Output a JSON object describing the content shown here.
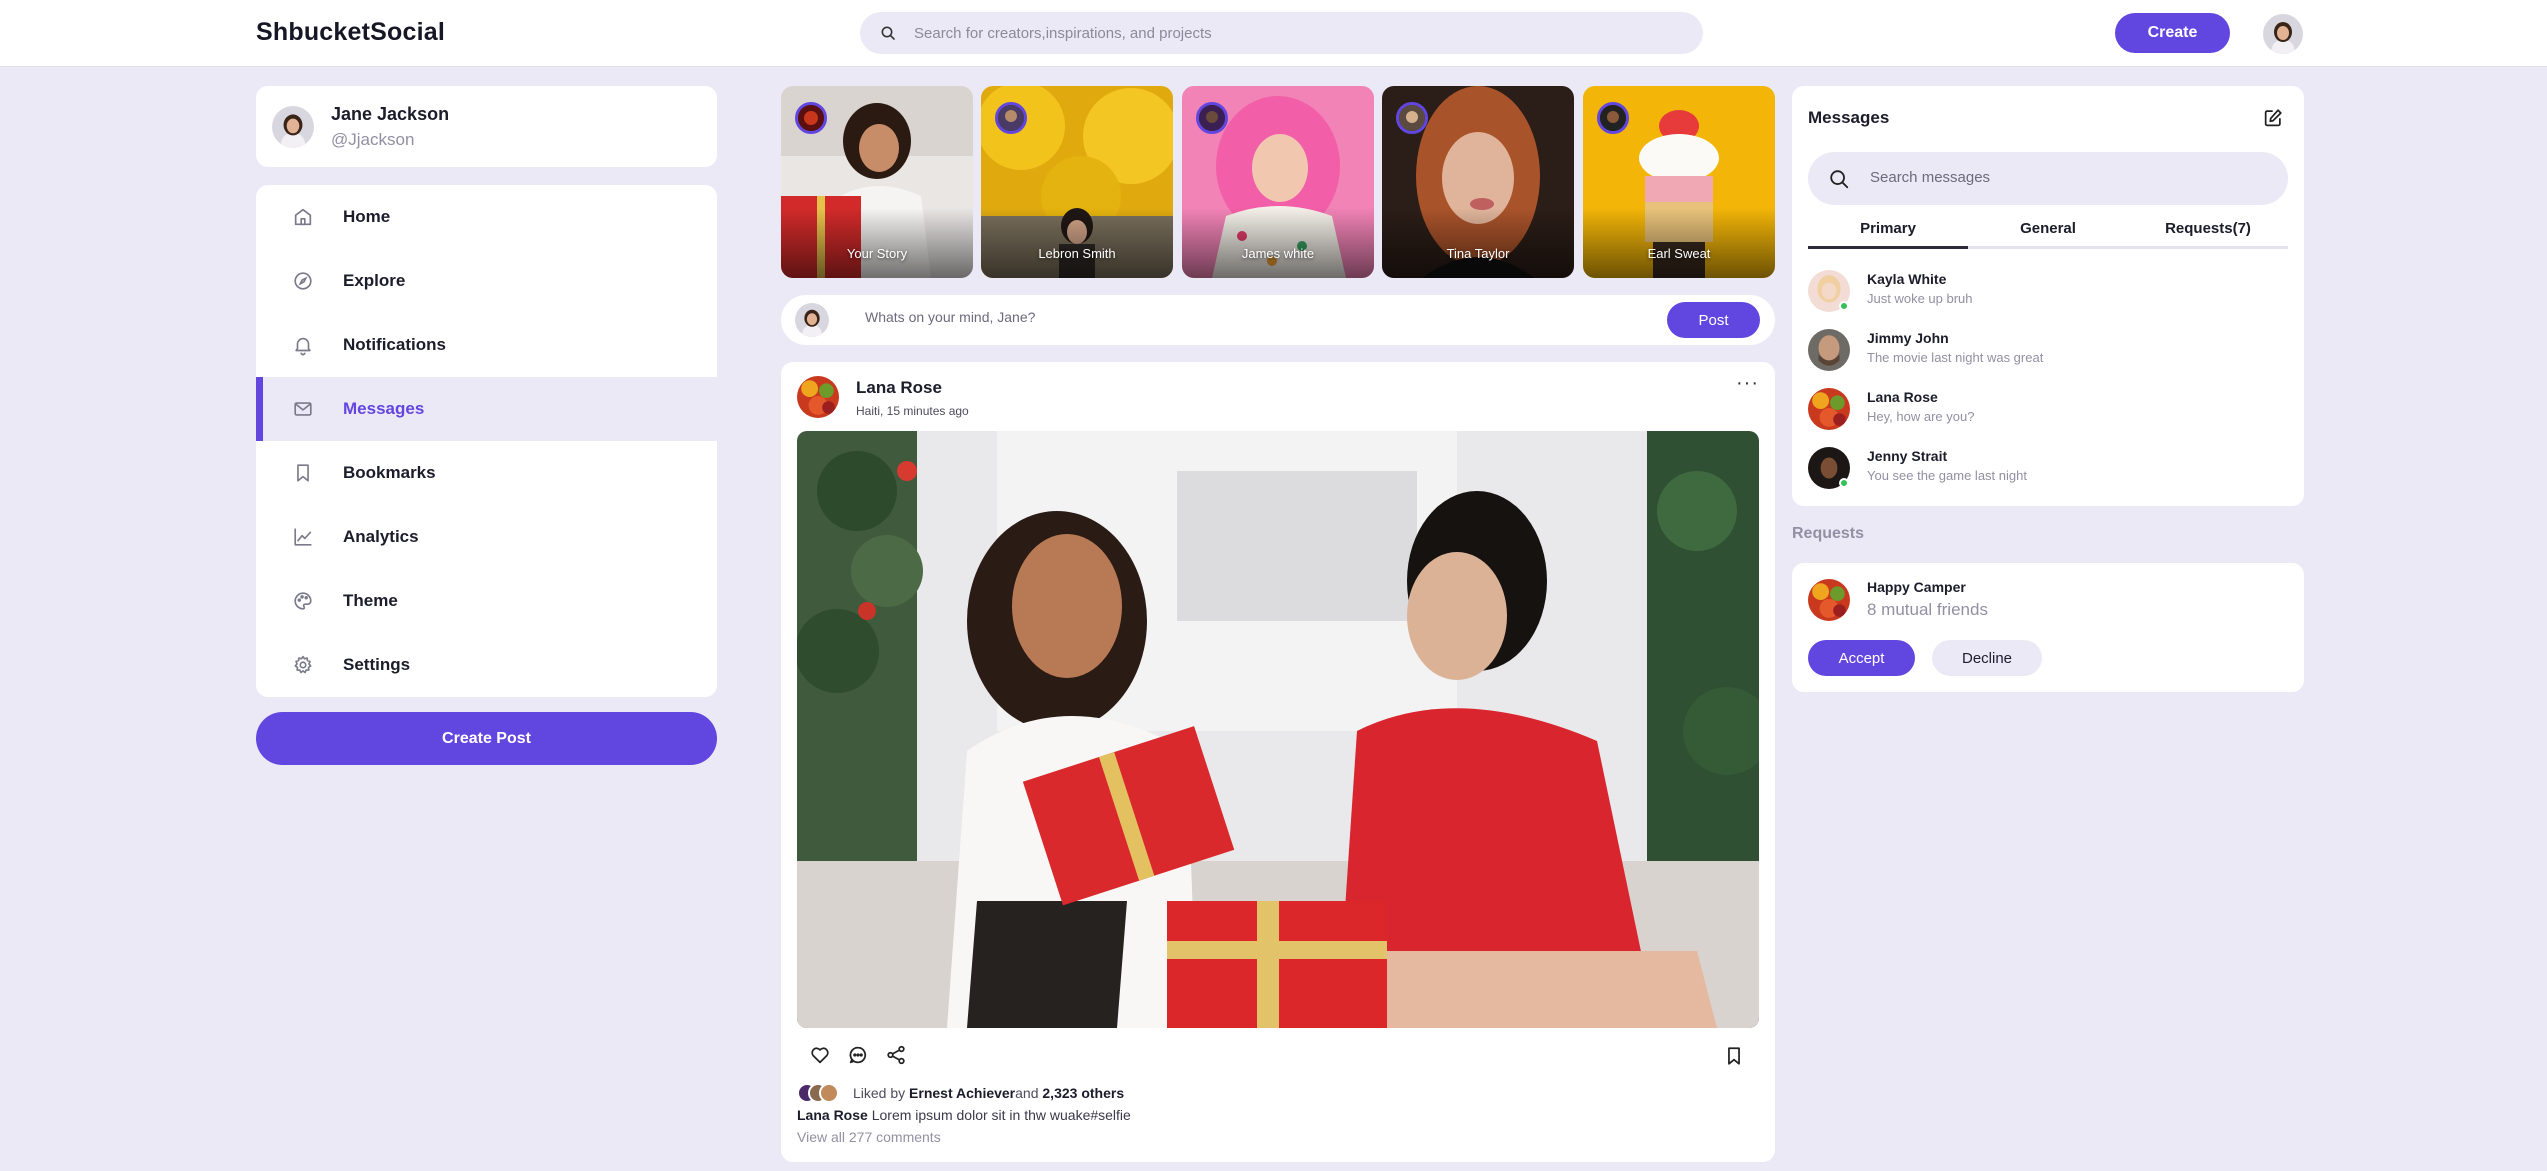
{
  "app": {
    "logo": "ShbucketSocial",
    "accent_color": "#6246e0",
    "background_color": "#ece9f6"
  },
  "topbar": {
    "search_placeholder": "Search for creators,inspirations, and projects",
    "search_icon": "search-icon",
    "create_label": "Create"
  },
  "profile": {
    "name": "Jane Jackson",
    "handle": "@Jjackson"
  },
  "nav": {
    "items": [
      {
        "label": "Home",
        "icon": "home-icon"
      },
      {
        "label": "Explore",
        "icon": "compass-icon"
      },
      {
        "label": "Notifications",
        "icon": "bell-icon"
      },
      {
        "label": "Messages",
        "icon": "mail-icon",
        "active": true
      },
      {
        "label": "Bookmarks",
        "icon": "bookmark-icon"
      },
      {
        "label": "Analytics",
        "icon": "chart-icon"
      },
      {
        "label": "Theme",
        "icon": "palette-icon"
      },
      {
        "label": "Settings",
        "icon": "gear-icon"
      }
    ],
    "create_post_label": "Create Post"
  },
  "stories": [
    {
      "name": "Your Story"
    },
    {
      "name": "Lebron Smith"
    },
    {
      "name": "James white"
    },
    {
      "name": "Tina Taylor"
    },
    {
      "name": "Earl Sweat"
    }
  ],
  "composer": {
    "placeholder": "Whats on your mind, Jane?",
    "post_label": "Post"
  },
  "post": {
    "author": "Lana Rose",
    "meta": "Haiti, 15 minutes ago",
    "more": "···",
    "liked_prefix": "Liked by",
    "liked_by": "Ernest Achiever",
    "liked_and": "and",
    "liked_others": "2,323 others",
    "caption_author": "Lana Rose",
    "caption_text": "Lorem ipsum dolor sit in thw wuake#selfie",
    "view_comments": "View all 277 comments"
  },
  "messages": {
    "title": "Messages",
    "search_placeholder": "Search messages",
    "tabs": [
      {
        "label": "Primary",
        "active": true
      },
      {
        "label": "General"
      },
      {
        "label": "Requests(7)"
      }
    ],
    "items": [
      {
        "name": "Kayla White",
        "text": "Just woke up bruh",
        "online": true
      },
      {
        "name": "Jimmy John",
        "text": "The movie last night was great",
        "online": false
      },
      {
        "name": "Lana Rose",
        "text": "Hey, how are you?",
        "online": false
      },
      {
        "name": "Jenny Strait",
        "text": "You see the game last night",
        "online": true
      }
    ]
  },
  "requests": {
    "heading": "Requests",
    "name": "Happy Camper",
    "mutual": "8 mutual friends",
    "accept_label": "Accept",
    "decline_label": "Decline"
  }
}
